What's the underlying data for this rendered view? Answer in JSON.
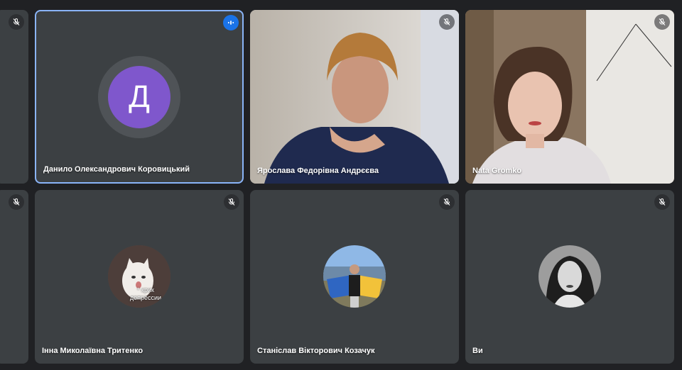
{
  "participants": [
    {
      "name": "",
      "muted": true
    },
    {
      "name": "Данило Олександрович Коровицький",
      "avatar_letter": "Д",
      "avatar_color": "#7f57cc",
      "speaking": true
    },
    {
      "name": "Ярослава Федорівна Андрєєва",
      "muted": true,
      "video": "woman-with-glasses-video"
    },
    {
      "name": "Nata Gromko",
      "muted": true,
      "video": "young-woman-video"
    },
    {
      "name": "",
      "muted": true
    },
    {
      "name": "Інна Миколаївна Тритенко",
      "muted": true,
      "avatar_text": "* крик депрессии"
    },
    {
      "name": "Станіслав Вікторович Козачук",
      "muted": true,
      "avatar": "man-with-flag-photo"
    },
    {
      "name": "Ви",
      "muted": true,
      "avatar": "woman-portrait-photo"
    }
  ],
  "icons": {
    "muted": "mic-off-icon",
    "speaking": "speaking-indicator-icon"
  },
  "colors": {
    "background": "#202124",
    "tile": "#3c4043",
    "active_border": "#8ab4f8",
    "speaking_badge": "#1a73e8"
  }
}
